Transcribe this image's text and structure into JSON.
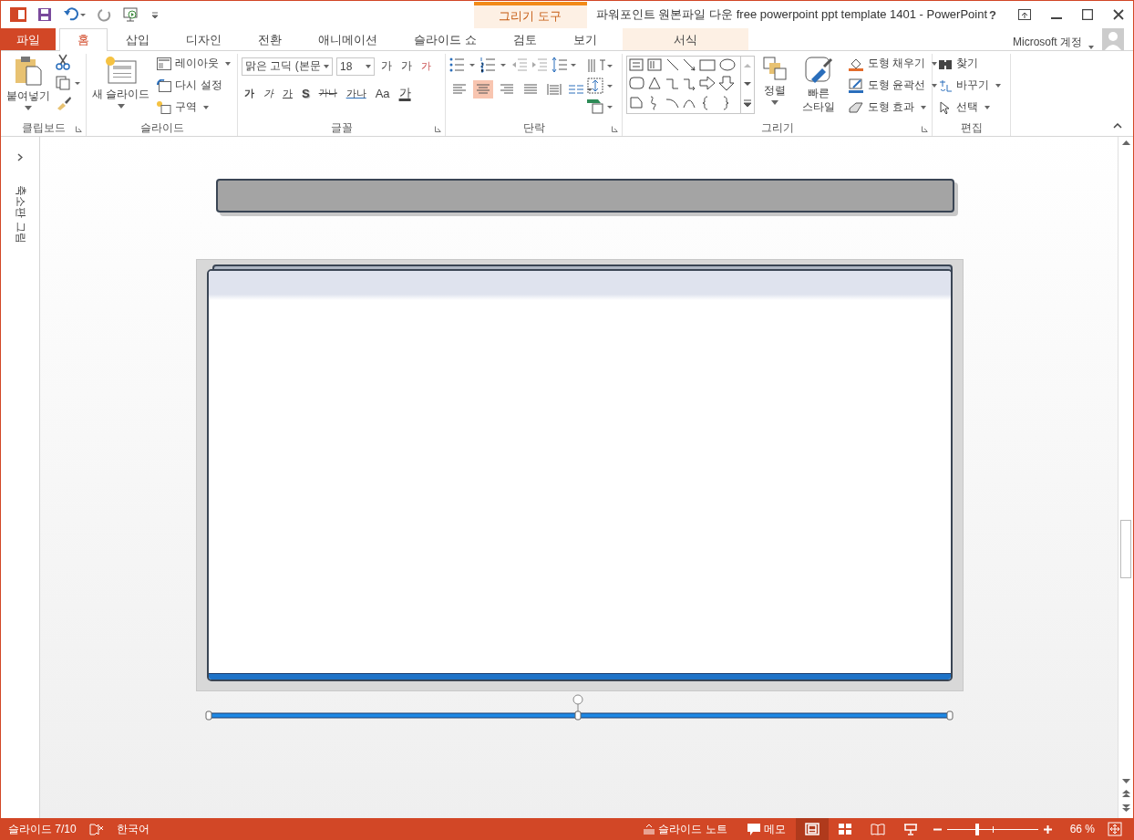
{
  "window": {
    "title": "파워포인트 원본파일 다운 free powerpoint ppt template 1401 - PowerPoint",
    "help": "?",
    "context_label": "그리기 도구",
    "account": "Microsoft 계정"
  },
  "tabs": [
    {
      "label": "파일",
      "kind": "file",
      "selected": false
    },
    {
      "label": "홈",
      "kind": "normal",
      "selected": true
    },
    {
      "label": "삽입",
      "kind": "normal",
      "selected": false
    },
    {
      "label": "디자인",
      "kind": "normal",
      "selected": false
    },
    {
      "label": "전환",
      "kind": "normal",
      "selected": false
    },
    {
      "label": "애니메이션",
      "kind": "normal",
      "selected": false
    },
    {
      "label": "슬라이드 쇼",
      "kind": "normal",
      "selected": false
    },
    {
      "label": "검토",
      "kind": "normal",
      "selected": false
    },
    {
      "label": "보기",
      "kind": "normal",
      "selected": false
    },
    {
      "label": "서식",
      "kind": "context",
      "selected": false
    }
  ],
  "clipboard": {
    "label": "클립보드",
    "paste": "붙여넣기"
  },
  "slides": {
    "label": "슬라이드",
    "new_slide": "새 슬라이드",
    "layout": "레이아웃",
    "reset": "다시 설정",
    "section": "구역"
  },
  "font": {
    "label": "글꼴",
    "name": "맑은 고딕 (본문",
    "size": "18",
    "row1": [
      {
        "kind": "grow",
        "text": "가"
      },
      {
        "kind": "shrink",
        "text": "가"
      },
      {
        "kind": "clear",
        "text": "가"
      }
    ],
    "row2": [
      {
        "kind": "bold",
        "text": "가"
      },
      {
        "kind": "italic",
        "text": "가"
      },
      {
        "kind": "underline",
        "text": "가"
      },
      {
        "kind": "shadow",
        "text": "S"
      },
      {
        "kind": "strike",
        "text": "가나"
      },
      {
        "kind": "spacing",
        "text": "가나"
      },
      {
        "kind": "case",
        "text": "Aa"
      },
      {
        "kind": "color",
        "text": "가"
      }
    ]
  },
  "paragraph": {
    "label": "단락",
    "align": [
      {
        "kind": "left",
        "selected": false
      },
      {
        "kind": "center",
        "selected": true
      },
      {
        "kind": "right",
        "selected": false
      },
      {
        "kind": "justify",
        "selected": false
      },
      {
        "kind": "distributed",
        "selected": false
      }
    ]
  },
  "drawing": {
    "label": "그리기",
    "arrange": "정렬",
    "quick_styles": "빠른 스타일",
    "fill": "도형 채우기",
    "outline": "도형 윤곽선",
    "effects": "도형 효과"
  },
  "editing": {
    "label": "편집",
    "find": "찾기",
    "replace": "바꾸기",
    "select": "선택"
  },
  "thumbnails": {
    "label": "축소판 그림"
  },
  "status_bar": {
    "slide": "슬라이드 7/10",
    "language": "한국어",
    "notes": "슬라이드 노트",
    "comments": "메모",
    "views": [
      {
        "kind": "normal",
        "selected": true
      },
      {
        "kind": "sorter",
        "selected": false
      },
      {
        "kind": "reading",
        "selected": false
      },
      {
        "kind": "show",
        "selected": false
      }
    ],
    "zoom": {
      "level": 0.33,
      "reading": "66 %"
    }
  }
}
